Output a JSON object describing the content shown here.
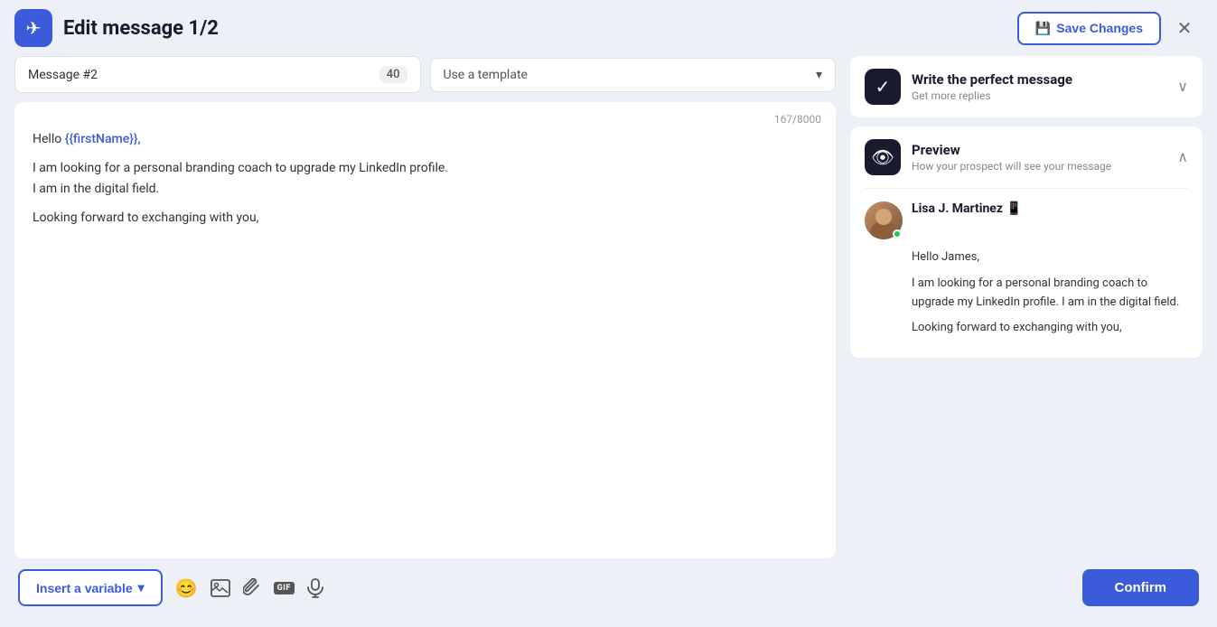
{
  "header": {
    "title": "Edit message 1/2",
    "save_changes_label": "Save Changes",
    "logo_icon": "✈"
  },
  "controls": {
    "message_label": "Message #2",
    "char_count": "40",
    "template_placeholder": "Use a template"
  },
  "editor": {
    "char_limit_info": "167/8000",
    "content_lines": [
      "Hello {{firstName}},",
      "",
      "I am looking for a personal branding coach to upgrade my LinkedIn profile.",
      "I am in the digital field.",
      "",
      "Looking forward to exchanging with you,"
    ]
  },
  "right_panel": {
    "write_message": {
      "title": "Write the perfect message",
      "subtitle": "Get more replies",
      "icon": "✓"
    },
    "preview": {
      "title": "Preview",
      "subtitle": "How your prospect will see your message",
      "icon": "👁",
      "prospect": {
        "name": "Lisa J. Martinez 📱",
        "online": true
      },
      "preview_lines": [
        "Hello James,",
        "",
        "I am looking for a personal branding coach to upgrade my LinkedIn profile. I am in the digital field.",
        "",
        "Looking forward to exchanging with you,"
      ]
    }
  },
  "bottom_bar": {
    "insert_variable_label": "Insert a variable",
    "confirm_label": "Confirm",
    "icons": {
      "emoji": "😊",
      "image": "🖼",
      "attachment": "📎",
      "gif": "GIF",
      "mic": "🎤"
    }
  }
}
